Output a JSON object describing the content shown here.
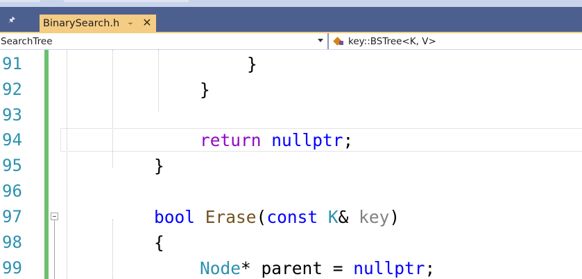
{
  "tab": {
    "title": "BinarySearch.h",
    "pin_glyph": "⨪",
    "close_glyph": "✕"
  },
  "navbar": {
    "scope": "SearchTree",
    "member": "key::BSTree<K, V>"
  },
  "editor": {
    "line_numbers": [
      "91",
      "92",
      "93",
      "94",
      "95",
      "96",
      "97",
      "98",
      "99"
    ],
    "lines": [
      {
        "text": "}"
      },
      {
        "text": "}"
      },
      {
        "text": ""
      },
      {
        "kw_return": "return",
        "space": " ",
        "kw_null": "nullptr",
        "punct": ";"
      },
      {
        "text": "}"
      },
      {
        "text": ""
      },
      {
        "kw_bool": "bool",
        "fn": "Erase",
        "p1": "(",
        "kw_const": "const",
        "type": "K",
        "amp": "&",
        "param": "key",
        "p2": ")"
      },
      {
        "text": "{"
      },
      {
        "type": "Node",
        "rest": "* parent = ",
        "kw_null": "nullptr",
        "punct": ";"
      }
    ]
  },
  "colors": {
    "tab_active": "#f5cc84",
    "tab_bar": "#4d5f8f",
    "line_number": "#2b91af",
    "keyword": "#0000ff",
    "control_keyword": "#8f08c4",
    "function": "#74531f",
    "change_bar": "#6cc070"
  }
}
